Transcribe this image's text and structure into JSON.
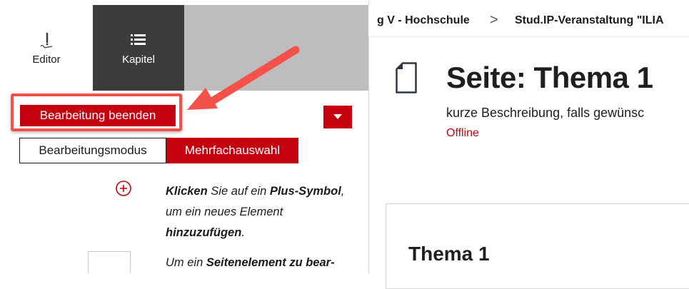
{
  "tabs": {
    "editor_label": "Editor",
    "kapitel_label": "Kapitel"
  },
  "toolbar": {
    "end_editing_label": "Bearbeitung beenden",
    "dropdown_icon": "caret-down-icon"
  },
  "modes": {
    "edit_mode_label": "Bearbeitungsmodus",
    "multi_select_label": "Mehrfachauswahl"
  },
  "help": {
    "plus_icon": "plus-circle-icon",
    "click_word": "Klicken",
    "text1": " Sie auf ein ",
    "plus_word": "Plus-Symbol",
    "text2": ", um ein neues Element ",
    "add_word": "hinzuzufügen",
    "text3": ".",
    "line2_start": "Um ein ",
    "line2_bold": "Seitenelement zu bear-"
  },
  "breadcrumb": {
    "item1": "g V - Hochschule",
    "separator": ">",
    "item2": "Stud.IP-Veranstaltung \"ILIA"
  },
  "page": {
    "title": "Seite: Thema 1",
    "description": "kurze Beschreibung, falls gewünsc",
    "status": "Offline",
    "content_heading": "Thema 1"
  },
  "colors": {
    "accent": "#c5000f",
    "tab_dark": "#3c3c3c",
    "highlight": "#f4514b"
  }
}
